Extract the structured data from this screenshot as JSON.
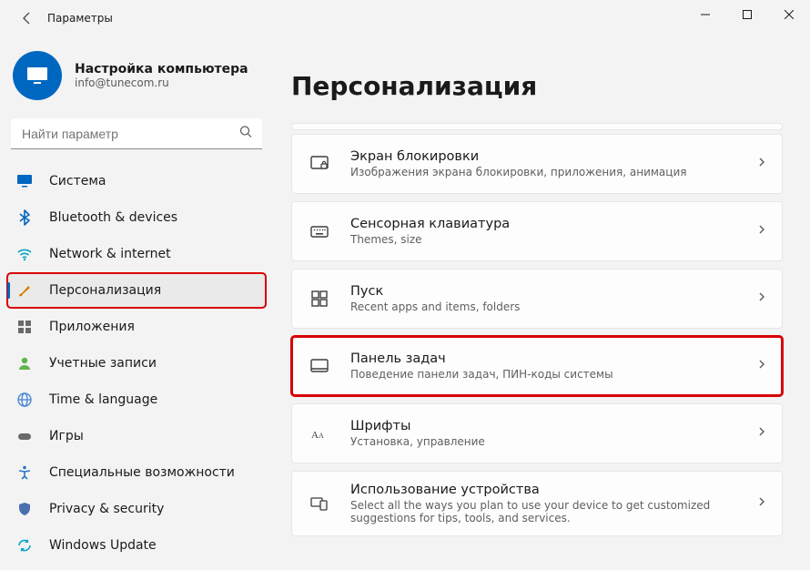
{
  "window": {
    "title": "Параметры"
  },
  "account": {
    "name": "Настройка компьютера",
    "email": "info@tunecom.ru"
  },
  "search": {
    "placeholder": "Найти параметр"
  },
  "nav": [
    {
      "id": "system",
      "label": "Система",
      "icon": "monitor",
      "color": "#0067c0"
    },
    {
      "id": "bluetooth",
      "label": "Bluetooth & devices",
      "icon": "bluetooth",
      "color": "#0067c0"
    },
    {
      "id": "network",
      "label": "Network & internet",
      "icon": "wifi",
      "color": "#0aa3c4"
    },
    {
      "id": "personalize",
      "label": "Персонализация",
      "icon": "brush",
      "color": "#d98200",
      "active": true,
      "redBox": true
    },
    {
      "id": "apps",
      "label": "Приложения",
      "icon": "grid",
      "color": "#6a6a6a"
    },
    {
      "id": "accounts",
      "label": "Учетные записи",
      "icon": "person",
      "color": "#60b44a"
    },
    {
      "id": "time",
      "label": "Time & language",
      "icon": "globe",
      "color": "#4b89d8"
    },
    {
      "id": "gaming",
      "label": "Игры",
      "icon": "gamepad",
      "color": "#6a6a6a"
    },
    {
      "id": "accessibility",
      "label": "Специальные возможности",
      "icon": "accessibility",
      "color": "#2a74c5"
    },
    {
      "id": "privacy",
      "label": "Privacy & security",
      "icon": "shield",
      "color": "#4a6fb0"
    },
    {
      "id": "update",
      "label": "Windows Update",
      "icon": "refresh",
      "color": "#0aa3c4"
    }
  ],
  "page": {
    "title": "Персонализация"
  },
  "cards": [
    {
      "id": "lock",
      "icon": "lockscreen",
      "title": "Экран блокировки",
      "sub": "Изображения экрана блокировки, приложения, анимация"
    },
    {
      "id": "touchkb",
      "icon": "keyboard",
      "title": "Сенсорная клавиатура",
      "sub": "Themes, size"
    },
    {
      "id": "start",
      "icon": "start",
      "title": "Пуск",
      "sub": "Recent apps and items, folders"
    },
    {
      "id": "taskbar",
      "icon": "taskbar",
      "title": "Панель задач",
      "sub": "Поведение панели задач, ПИН-коды системы",
      "redBox": true
    },
    {
      "id": "fonts",
      "icon": "fonts",
      "title": "Шрифты",
      "sub": "Установка, управление"
    },
    {
      "id": "usage",
      "icon": "usage",
      "title": "Использование устройства",
      "sub": "Select all the ways you plan to use your device to get customized suggestions for tips, tools, and services."
    }
  ]
}
